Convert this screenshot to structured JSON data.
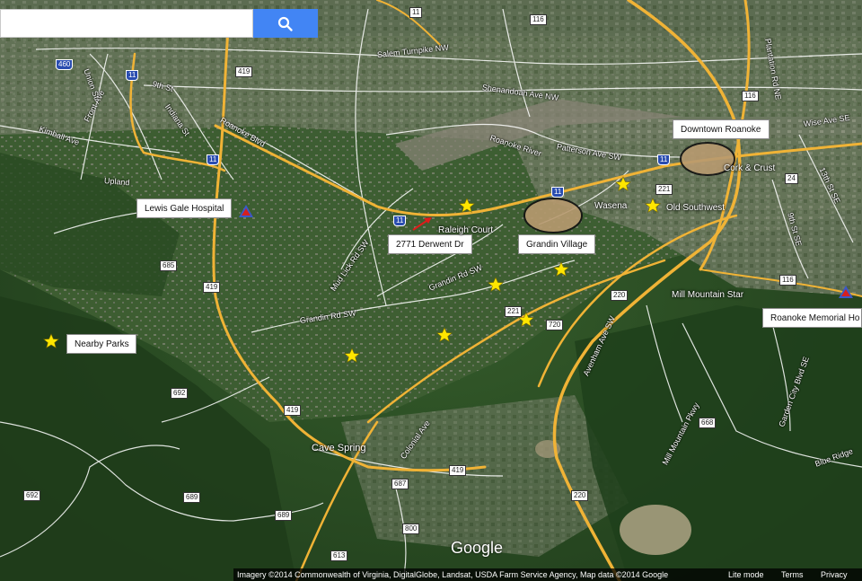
{
  "search": {
    "placeholder": "",
    "button_icon": "search-icon"
  },
  "colors": {
    "marker_red": "#d61f1f",
    "marker_blue": "#3a59c8",
    "star": "#ffe600",
    "highway": "#f0b336",
    "road": "#ffffff",
    "search_button": "#4285f4"
  },
  "labels": {
    "downtown": "Downtown Roanoke",
    "lewis_gale": "Lewis Gale Hospital",
    "address": "2771 Derwent Dr",
    "grandin": "Grandin Village",
    "roanoke_memorial": "Roanoke Memorial Ho",
    "nearby_parks": "Nearby Parks"
  },
  "places": {
    "cave_spring": "Cave Spring",
    "wasena": "Wasena",
    "old_southwest": "Old Southwest",
    "mill_mountain_star": "Mill Mountain Star",
    "cork_crust": "Cork & Crust",
    "raleigh_court": "Raleigh Court"
  },
  "roads": {
    "salem_turnpike": "Salem Turnpike NW",
    "shenandoah": "Shenandoah Ave NW",
    "patterson": "Patterson Ave SW",
    "roanoke_river": "Roanoke River",
    "wise_ave": "Wise Ave SE",
    "grandin_rd_1": "Grandin Rd SW",
    "grandin_rd_2": "Grandin Rd SW",
    "mud_lick": "Mud Lick Rd SW",
    "colonial": "Colonial Ave",
    "avenham": "Avenham Ave SW",
    "mill_mountain_pkwy": "Mill Mountain Pkwy",
    "garden_city": "Garden City Blvd SE",
    "blue_ridge": "Blue Ridge",
    "kimball": "Kimball Ave",
    "front_ave": "Front Ave",
    "ninth_st": "9th St",
    "indiana": "Indiana St",
    "roanoke_blvd": "Roanoke Blvd",
    "upland": "Upland",
    "union": "Union St",
    "plantation": "Plantation Rd NE",
    "ninth_st_se": "9th St SE",
    "thirteenth": "13th St SE"
  },
  "shields": {
    "s11_top": "11",
    "s116_top": "116",
    "s460": "460",
    "s11_a": "11",
    "s419_top": "419",
    "s11_b": "11",
    "s11_c": "11",
    "s11_d": "11",
    "s221_a": "221",
    "s24": "24",
    "s116_r": "116",
    "s685": "685",
    "s419_m": "419",
    "s220_a": "220",
    "s221_b": "221",
    "s720": "720",
    "s692_a": "692",
    "s419_b": "419",
    "s668": "668",
    "s419_c": "419",
    "s687": "687",
    "s220_b": "220",
    "s689_a": "689",
    "s689_b": "689",
    "s692_b": "692",
    "s800": "800",
    "s613": "613",
    "s11_e": "11",
    "s116_e": "116"
  },
  "footer": {
    "attribution": "Imagery ©2014 Commonwealth of Virginia, DigitalGlobe, Landsat, USDA Farm Service Agency, Map data ©2014 Google",
    "lite_mode": "Lite mode",
    "terms": "Terms",
    "privacy": "Privacy",
    "logo": "Google"
  }
}
